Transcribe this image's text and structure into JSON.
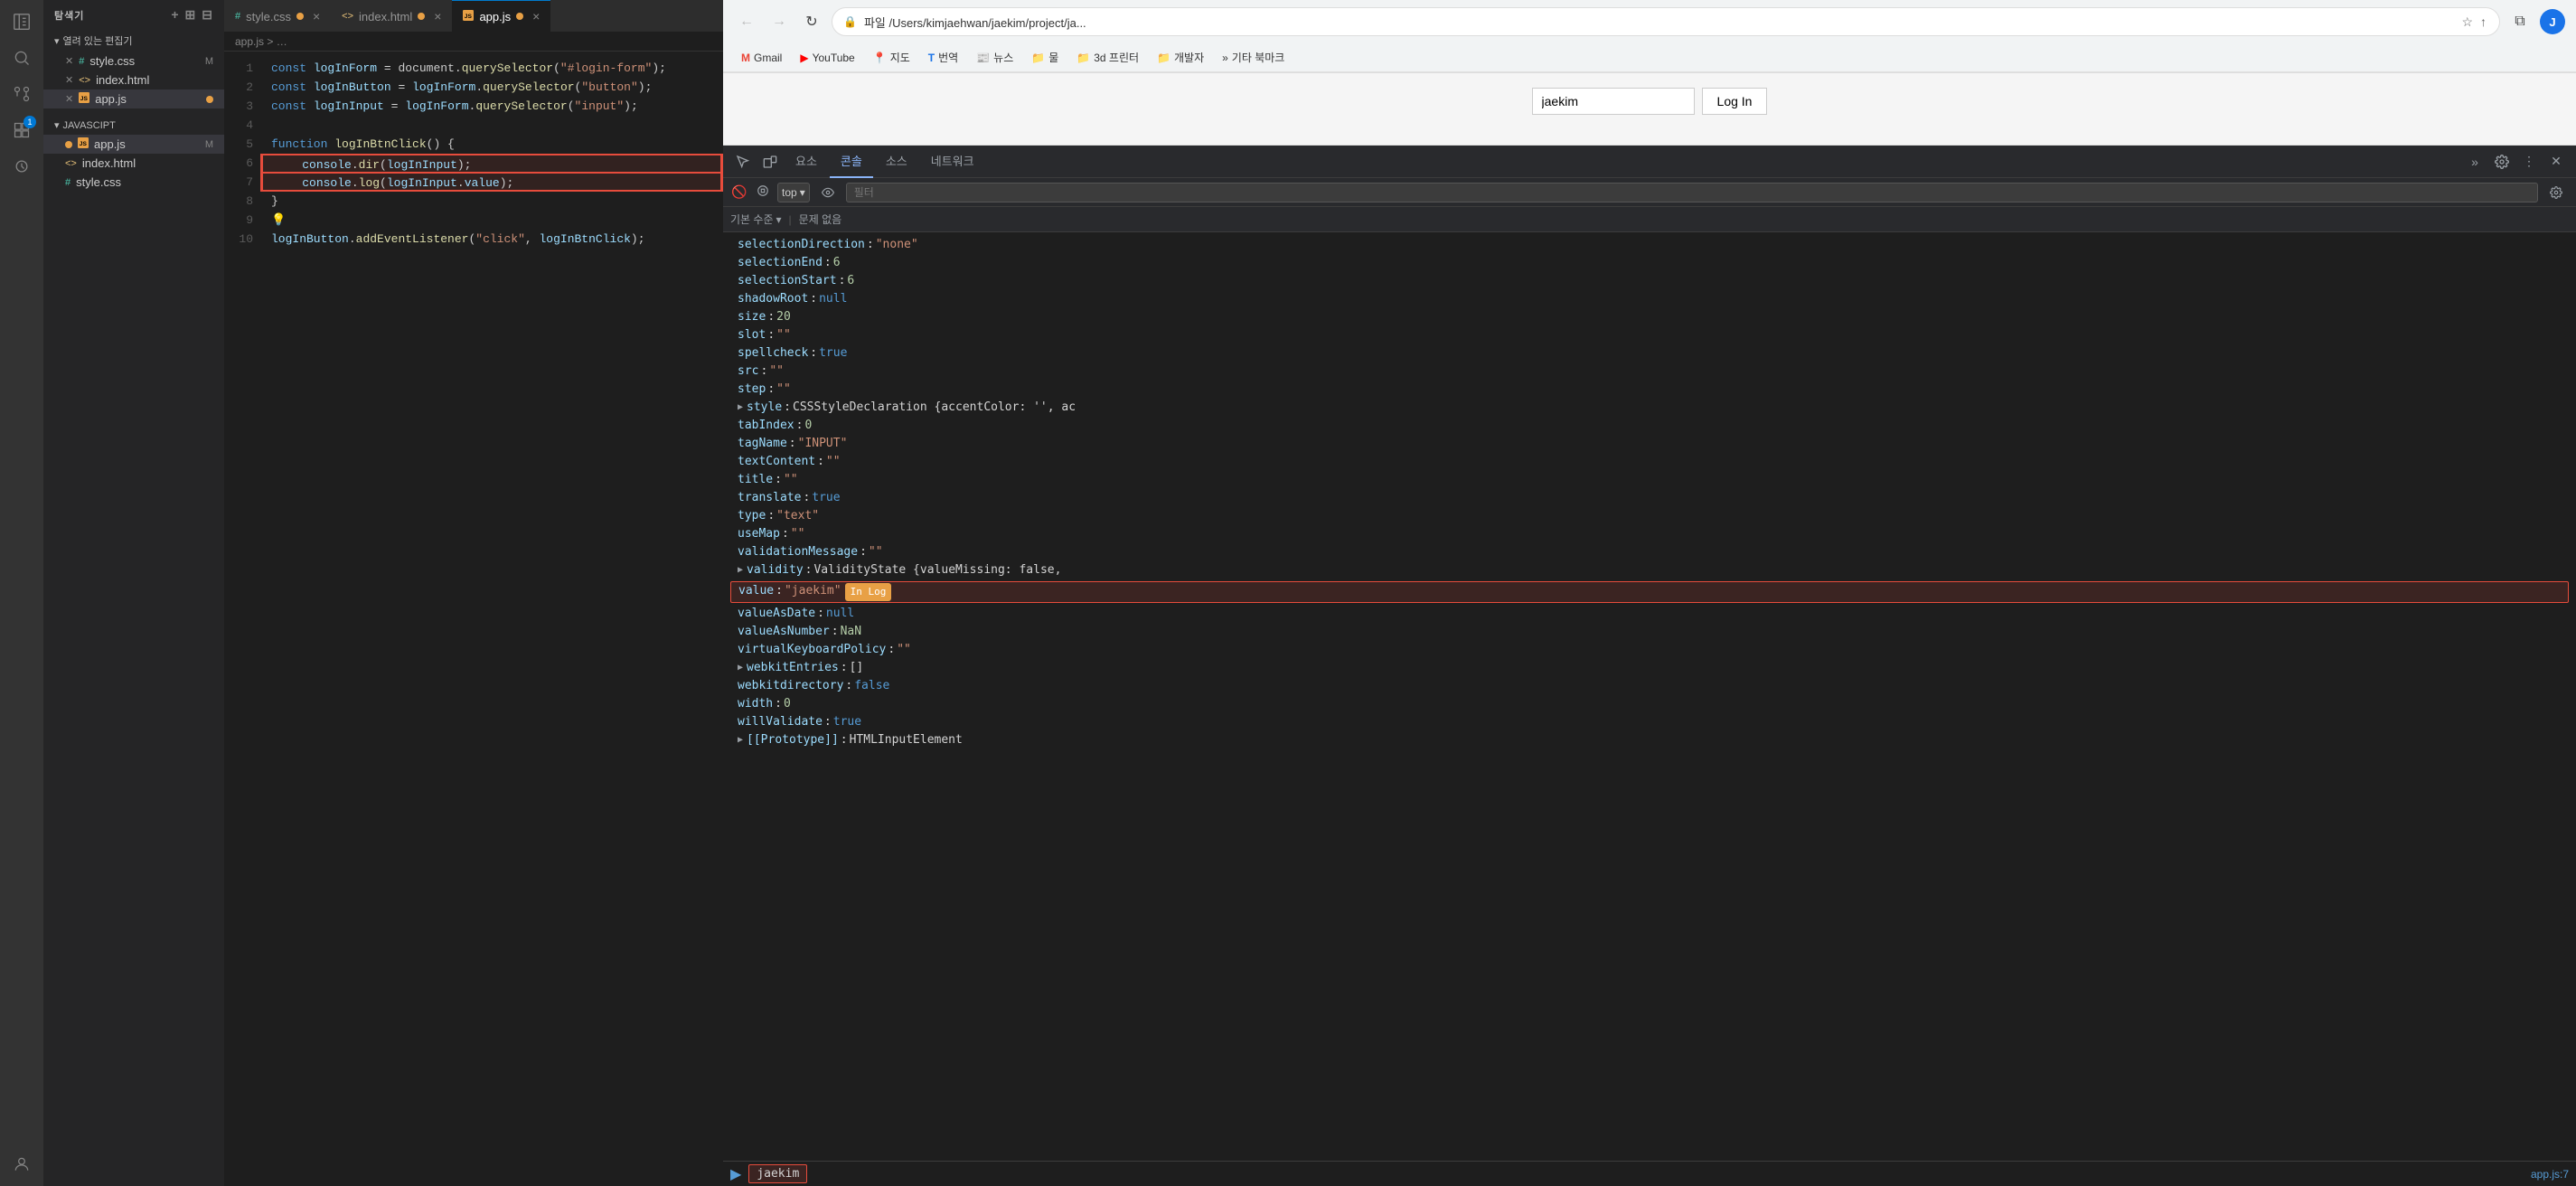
{
  "vscode": {
    "activity_icons": [
      {
        "name": "explorer-icon",
        "symbol": "⎇",
        "active": false
      },
      {
        "name": "search-icon",
        "symbol": "🔍",
        "active": false
      },
      {
        "name": "source-control-icon",
        "symbol": "⎇",
        "active": false
      },
      {
        "name": "extensions-icon",
        "symbol": "⧉",
        "active": false,
        "badge": true
      },
      {
        "name": "debug-icon",
        "symbol": "▶",
        "active": false
      },
      {
        "name": "remote-icon",
        "symbol": "◯",
        "active": false
      }
    ],
    "sidebar": {
      "title": "탐색기",
      "section_open": "열려 있는 편집기",
      "open_files": [
        {
          "name": "style.css",
          "modified": true,
          "icon": "#",
          "color": "#4ec9b0"
        },
        {
          "name": "index.html",
          "modified": false,
          "icon": "<>",
          "color": "#e8c27a"
        },
        {
          "name": "app.js",
          "modified": true,
          "icon": "JS",
          "color": "#e8a045",
          "active": true
        }
      ],
      "project_section": "JAVASCIPT",
      "project_files": [
        {
          "name": "app.js",
          "modified": true,
          "icon": "JS",
          "color": "#e8a045",
          "active": true
        },
        {
          "name": "index.html",
          "modified": false,
          "icon": "<>",
          "color": "#e8c27a"
        },
        {
          "name": "style.css",
          "modified": false,
          "icon": "#",
          "color": "#4ec9b0"
        }
      ]
    },
    "tabs": [
      {
        "label": "style.css",
        "modified": true,
        "active": false
      },
      {
        "label": "index.html",
        "modified": true,
        "active": false
      },
      {
        "label": "app.js",
        "modified": true,
        "active": true
      }
    ],
    "breadcrumb": "app.js > …",
    "code_lines": [
      {
        "num": 1,
        "content": "const logInForm = document.querySelector(\"#login-form\");",
        "highlight": false
      },
      {
        "num": 2,
        "content": "const logInButton = logInForm.querySelector(\"button\");",
        "highlight": false
      },
      {
        "num": 3,
        "content": "const logInInput = logInForm.querySelector(\"input\");",
        "highlight": false
      },
      {
        "num": 4,
        "content": "",
        "highlight": false
      },
      {
        "num": 5,
        "content": "function logInBtnClick() {",
        "highlight": false
      },
      {
        "num": 6,
        "content": "    console.dir(logInInput);",
        "highlight": true
      },
      {
        "num": 7,
        "content": "    console.log(logInInput.value);",
        "highlight": true
      },
      {
        "num": 8,
        "content": "}",
        "highlight": false
      },
      {
        "num": 9,
        "content": "",
        "highlight": false
      },
      {
        "num": 10,
        "content": "logInButton.addEventListener(\"click\", logInBtnClick);",
        "highlight": false
      }
    ]
  },
  "browser": {
    "nav": {
      "back_disabled": true,
      "forward_disabled": true
    },
    "address": "파일  /Users/kimjaehwan/jaekim/project/ja...",
    "bookmarks": [
      {
        "label": "Gmail",
        "icon": "G"
      },
      {
        "label": "YouTube",
        "icon": "▶"
      },
      {
        "label": "지도",
        "icon": "📍"
      },
      {
        "label": "번역",
        "icon": "T"
      },
      {
        "label": "뉴스",
        "icon": "N"
      },
      {
        "label": "물",
        "icon": "■"
      },
      {
        "label": "3d 프린터",
        "icon": "■"
      },
      {
        "label": "개발자",
        "icon": "■"
      },
      {
        "label": "기타 북마크",
        "icon": "»"
      }
    ],
    "webpage": {
      "login_input_value": "jaekim",
      "login_button_label": "Log In"
    },
    "devtools": {
      "tabs": [
        {
          "label": "요소",
          "active": false
        },
        {
          "label": "콘솔",
          "active": true
        },
        {
          "label": "소스",
          "active": false
        },
        {
          "label": "네트워크",
          "active": false
        }
      ],
      "console_toolbar": {
        "top_label": "top",
        "filter_placeholder": "필터",
        "level_label": "기본 수준",
        "no_issues_label": "문제 없음"
      },
      "properties": [
        {
          "key": "selectionDirection",
          "colon": ":",
          "value": "\"none\"",
          "type": "str",
          "indent": 0
        },
        {
          "key": "selectionEnd",
          "colon": ":",
          "value": "6",
          "type": "num",
          "indent": 0
        },
        {
          "key": "selectionStart",
          "colon": ":",
          "value": "6",
          "type": "num",
          "indent": 0
        },
        {
          "key": "shadowRoot",
          "colon": ":",
          "value": "null",
          "type": "null",
          "indent": 0
        },
        {
          "key": "size",
          "colon": ":",
          "value": "20",
          "type": "num",
          "indent": 0
        },
        {
          "key": "slot",
          "colon": ":",
          "value": "\"\"",
          "type": "str",
          "indent": 0
        },
        {
          "key": "spellcheck",
          "colon": ":",
          "value": "true",
          "type": "bool",
          "indent": 0
        },
        {
          "key": "src",
          "colon": ":",
          "value": "\"\"",
          "type": "str",
          "indent": 0
        },
        {
          "key": "step",
          "colon": ":",
          "value": "\"\"",
          "type": "str",
          "indent": 0
        },
        {
          "key": "style",
          "colon": ":",
          "value": "CSSStyleDeclaration {accentColor: '', ac",
          "type": "obj",
          "indent": 0,
          "expandable": true
        },
        {
          "key": "tabIndex",
          "colon": ":",
          "value": "0",
          "type": "num",
          "indent": 0
        },
        {
          "key": "tagName",
          "colon": ":",
          "value": "\"INPUT\"",
          "type": "str",
          "indent": 0
        },
        {
          "key": "textContent",
          "colon": ":",
          "value": "\"\"",
          "type": "str",
          "indent": 0
        },
        {
          "key": "title",
          "colon": ":",
          "value": "\"\"",
          "type": "str",
          "indent": 0
        },
        {
          "key": "translate",
          "colon": ":",
          "value": "true",
          "type": "bool",
          "indent": 0
        },
        {
          "key": "type",
          "colon": ":",
          "value": "\"text\"",
          "type": "str",
          "indent": 0
        },
        {
          "key": "useMap",
          "colon": ":",
          "value": "\"\"",
          "type": "str",
          "indent": 0
        },
        {
          "key": "validationMessage",
          "colon": ":",
          "value": "\"\"",
          "type": "str",
          "indent": 0
        },
        {
          "key": "validity",
          "colon": ":",
          "value": "ValidityState {valueMissing: false,",
          "type": "obj",
          "indent": 0,
          "expandable": true
        },
        {
          "key": "value",
          "colon": ":",
          "value": "\"jaekim\"",
          "type": "str",
          "indent": 0,
          "highlighted": true
        },
        {
          "key": "valueAsDate",
          "colon": ":",
          "value": "null",
          "type": "null",
          "indent": 0
        },
        {
          "key": "valueAsNumber",
          "colon": ":",
          "value": "NaN",
          "type": "num",
          "indent": 0
        },
        {
          "key": "virtualKeyboardPolicy",
          "colon": ":",
          "value": "\"\"",
          "type": "str",
          "indent": 0
        },
        {
          "key": "webkitEntries",
          "colon": ":",
          "value": "[]",
          "type": "obj",
          "indent": 0,
          "expandable": true
        },
        {
          "key": "webkitdirectory",
          "colon": ":",
          "value": "false",
          "type": "bool",
          "indent": 0
        },
        {
          "key": "width",
          "colon": ":",
          "value": "0",
          "type": "num",
          "indent": 0
        },
        {
          "key": "willValidate",
          "colon": ":",
          "value": "true",
          "type": "bool",
          "indent": 0
        },
        {
          "key": "[[Prototype]]",
          "colon": ":",
          "value": "HTMLInputElement",
          "type": "obj",
          "indent": 0,
          "expandable": true
        }
      ],
      "console_output": {
        "value": "jaekim",
        "file_ref": "app.js:7"
      }
    }
  }
}
